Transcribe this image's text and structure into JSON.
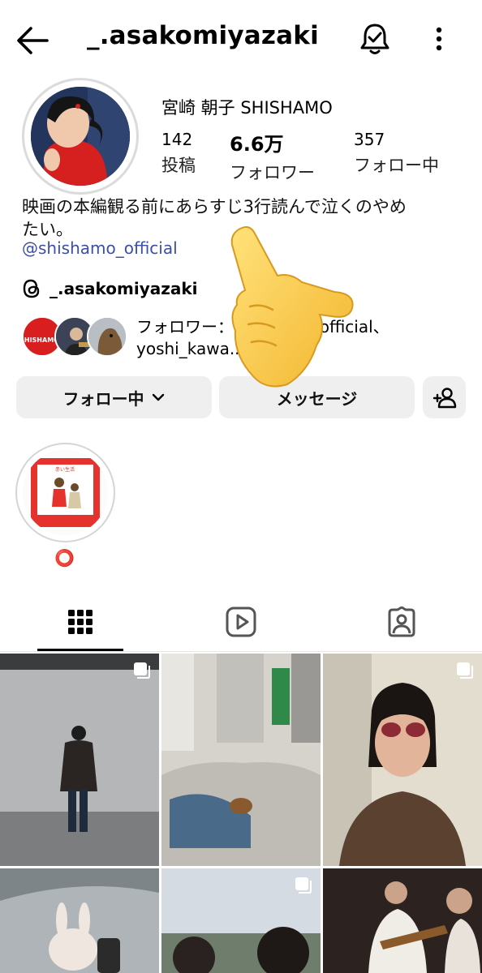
{
  "header": {
    "username": "_.asakomiyazaki",
    "back_icon": "arrow-left-icon",
    "bell_icon": "notification-bell-check-icon",
    "more_icon": "more-vertical-icon"
  },
  "profile": {
    "display_name": "宮崎 朝子 SHISHAMO",
    "stats": [
      {
        "value": "142",
        "label": "投稿"
      },
      {
        "value": "6.6万",
        "label": "フォロワー"
      },
      {
        "value": "357",
        "label": "フォロー中"
      }
    ],
    "bio_lines": [
      "映画の本編観る前にあらすじ3行読んで泣くのやめ",
      "たい。"
    ],
    "link": "@shishamo_official",
    "threads_handle": "_.asakomiyazaki"
  },
  "mutual": {
    "line1": "フォロワー：shishamo_official、",
    "line2": "yoshi_kawa..."
  },
  "actions": {
    "following_label": "フォロー中",
    "message_label": "メッセージ"
  },
  "highlights": [
    {
      "label": "⭕",
      "cover_text": "赤い生活"
    }
  ],
  "mutual_badge_text": "SHISHAMO!!!",
  "tabs": [
    "grid-icon",
    "reels-icon",
    "tagged-icon"
  ],
  "colors": {
    "link": "#3b4fa8",
    "button_bg": "#efefef",
    "highlight_label": "#e53935"
  }
}
